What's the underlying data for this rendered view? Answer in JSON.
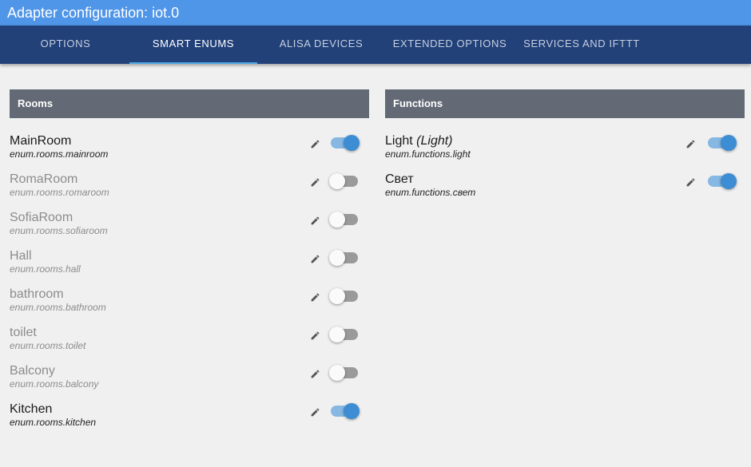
{
  "window": {
    "title": "Adapter configuration: iot.0"
  },
  "tabs": [
    {
      "label": "OPTIONS",
      "active": false
    },
    {
      "label": "SMART ENUMS",
      "active": true
    },
    {
      "label": "ALISA DEVICES",
      "active": false
    },
    {
      "label": "EXTENDED OPTIONS",
      "active": false
    },
    {
      "label": "SERVICES AND IFTTT",
      "active": false
    }
  ],
  "rooms": {
    "header": "Rooms",
    "items": [
      {
        "name": "MainRoom",
        "id": "enum.rooms.mainroom",
        "enabled": true
      },
      {
        "name": "RomaRoom",
        "id": "enum.rooms.romaroom",
        "enabled": false
      },
      {
        "name": "SofiaRoom",
        "id": "enum.rooms.sofiaroom",
        "enabled": false
      },
      {
        "name": "Hall",
        "id": "enum.rooms.hall",
        "enabled": false
      },
      {
        "name": "bathroom",
        "id": "enum.rooms.bathroom",
        "enabled": false
      },
      {
        "name": "toilet",
        "id": "enum.rooms.toilet",
        "enabled": false
      },
      {
        "name": "Balcony",
        "id": "enum.rooms.balcony",
        "enabled": false
      },
      {
        "name": "Kitchen",
        "id": "enum.rooms.kitchen",
        "enabled": true
      }
    ]
  },
  "functions": {
    "header": "Functions",
    "items": [
      {
        "name": "Light",
        "hint": "(Light)",
        "id": "enum.functions.light",
        "enabled": true
      },
      {
        "name": "Свет",
        "hint": "",
        "id": "enum.functions.свет",
        "enabled": true
      }
    ]
  },
  "icons": {
    "edit": "pencil-icon"
  },
  "colors": {
    "title_bar": "#4f95e8",
    "tab_bar": "#224179",
    "panel_header": "#636a76",
    "switch_on_thumb": "#3c8dd4",
    "switch_on_track": "#86b8e3",
    "switch_off_track": "#9a9a9a"
  }
}
